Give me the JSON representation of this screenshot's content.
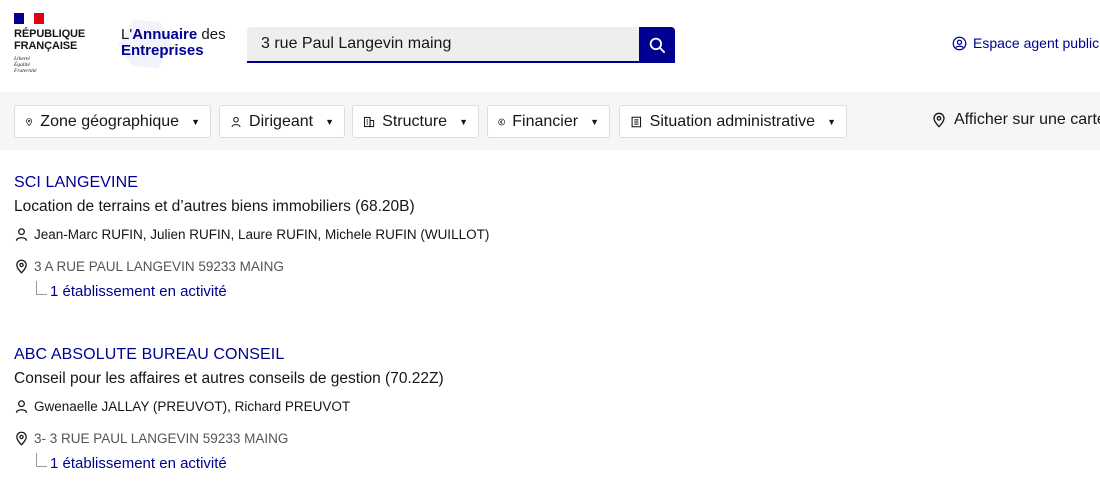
{
  "header": {
    "gov": {
      "name_line1": "RÉPUBLIQUE",
      "name_line2": "FRANÇAISE",
      "motto": [
        "Liberté",
        "Égalité",
        "Fraternité"
      ]
    },
    "brand": {
      "line1_prefix": "L'",
      "line1_bold": "Annuaire",
      "line1_suffix": " des",
      "line2": "Entreprises"
    },
    "search": {
      "value": "3 rue Paul Langevin maing",
      "button_icon": "search-icon"
    },
    "agent_link": {
      "label": "Espace agent public",
      "icon": "user-circle-icon"
    }
  },
  "filters": {
    "items": [
      {
        "label": "Zone géographique",
        "icon": "map-pin-icon"
      },
      {
        "label": "Dirigeant",
        "icon": "user-icon"
      },
      {
        "label": "Structure",
        "icon": "building-icon"
      },
      {
        "label": "Financier",
        "icon": "euro-icon"
      },
      {
        "label": "Situation administrative",
        "icon": "document-icon"
      }
    ],
    "map_link": {
      "label": "Afficher sur une carte",
      "icon": "map-pin-icon"
    }
  },
  "results": [
    {
      "name": "SCI LANGEVINE",
      "activity": "Location de terrains et d’autres biens immobiliers (68.20B)",
      "people": "Jean-Marc RUFIN, Julien RUFIN, Laure RUFIN, Michele RUFIN (WUILLOT)",
      "address": "3 A RUE PAUL LANGEVIN 59233 MAING",
      "establishments": "1 établissement en activité"
    },
    {
      "name": "ABC ABSOLUTE BUREAU CONSEIL",
      "activity": "Conseil pour les affaires et autres conseils de gestion (70.22Z)",
      "people": "Gwenaelle JALLAY (PREUVOT), Richard PREUVOT",
      "address": "3- 3 RUE PAUL LANGEVIN 59233 MAING",
      "establishments": "1 établissement en activité"
    }
  ],
  "colors": {
    "brand_blue": "#000091",
    "flag_red": "#e1000f",
    "filter_bg": "#f6f6f6"
  }
}
